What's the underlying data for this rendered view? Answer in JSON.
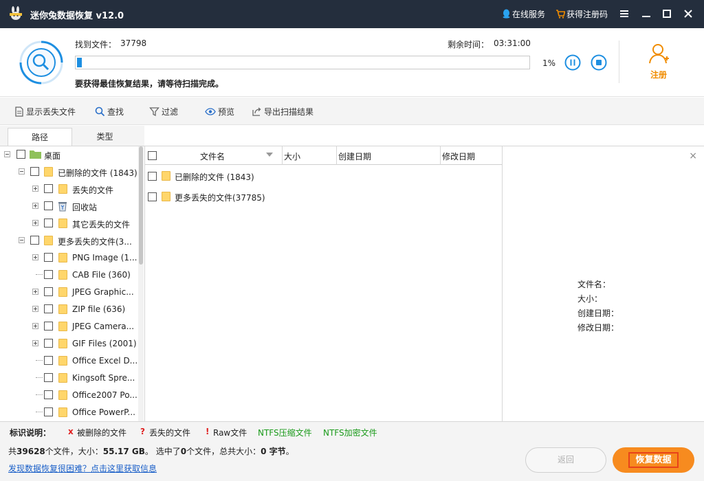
{
  "app": {
    "title": "迷你兔数据恢复 v12.0",
    "online_service": "在线服务",
    "get_code": "获得注册码"
  },
  "scan": {
    "found_label": "找到文件：",
    "found_count": "37798",
    "remaining_label": "剩余时间：",
    "remaining_time": "03:31:00",
    "percent_text": "1%",
    "progress_fraction": 0.01,
    "hint": "要获得最佳恢复结果，请等待扫描完成。"
  },
  "register": {
    "label": "注册"
  },
  "toolbar": {
    "show_lost": "显示丢失文件",
    "find": "查找",
    "filter": "过滤",
    "preview": "预览",
    "export": "导出扫描结果"
  },
  "tabs": {
    "path": "路径",
    "type": "类型"
  },
  "tree": {
    "root": "桌面",
    "items": [
      {
        "label": "已删除的文件 (1843)"
      },
      {
        "label": "丢失的文件"
      },
      {
        "label": "回收站"
      },
      {
        "label": "其它丢失的文件"
      },
      {
        "label": "更多丢失的文件(3..."
      },
      {
        "label": "PNG Image (1..."
      },
      {
        "label": "CAB File (360)"
      },
      {
        "label": "JPEG Graphic..."
      },
      {
        "label": "ZIP file (636)"
      },
      {
        "label": "JPEG Camera..."
      },
      {
        "label": "GIF Files (2001)"
      },
      {
        "label": "Office Excel D..."
      },
      {
        "label": "Kingsoft Spre..."
      },
      {
        "label": "Office2007 Po..."
      },
      {
        "label": "Office PowerP..."
      }
    ]
  },
  "filelist": {
    "columns": [
      "文件名",
      "大小",
      "创建日期",
      "修改日期"
    ],
    "rows": [
      {
        "name": "已删除的文件 (1843)"
      },
      {
        "name": "更多丢失的文件(37785)"
      }
    ]
  },
  "preview": {
    "close": "×",
    "filename_label": "文件名：",
    "size_label": "大小：",
    "created_label": "创建日期：",
    "modified_label": "修改日期："
  },
  "legend": {
    "title": "标识说明：",
    "deleted_mark": "x",
    "deleted": "被删除的文件",
    "lost_mark": "?",
    "lost": "丢失的文件",
    "raw_mark": "!",
    "raw": "Raw文件",
    "ntfs_compressed": "NTFS压缩文件",
    "ntfs_encrypted": "NTFS加密文件"
  },
  "summary": {
    "prefix": "共",
    "file_count": "39628",
    "files_size_label": "个文件，大小：",
    "total_size": "55.17 GB",
    "selected_prefix": "。 选中了",
    "selected_count": "0",
    "selected_mid": "个文件，总共大小：",
    "selected_size": "0 字节",
    "suffix": "。"
  },
  "help_link": "发现数据恢复很困难？点击这里获取信息",
  "buttons": {
    "back": "返回",
    "recover": "恢复数据"
  },
  "colors": {
    "titlebar": "#242e3d",
    "accent": "#1e8fe1",
    "orange": "#f78b1f",
    "red": "#e02020",
    "green": "#1a9a1a"
  }
}
